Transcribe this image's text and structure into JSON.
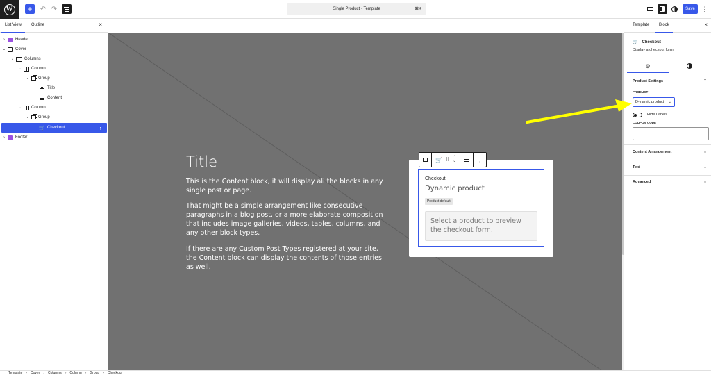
{
  "topbar": {
    "add_label": "+",
    "undo_label": "↶",
    "redo_label": "↷",
    "document_title": "Single Product · Template",
    "shortcut": "⌘K",
    "save_label": "Save",
    "more_label": "⋮"
  },
  "left_panel": {
    "tabs": [
      "List View",
      "Outline"
    ],
    "close_label": "×",
    "tree": [
      {
        "label": "Header",
        "icon": "header-icon"
      },
      {
        "label": "Cover",
        "icon": "cover-icon"
      },
      {
        "label": "Columns",
        "icon": "columns-icon"
      },
      {
        "label": "Column",
        "icon": "column-icon"
      },
      {
        "label": "Group",
        "icon": "group-icon"
      },
      {
        "label": "Title",
        "icon": "title-icon"
      },
      {
        "label": "Content",
        "icon": "content-icon"
      },
      {
        "label": "Column",
        "icon": "column-icon"
      },
      {
        "label": "Group",
        "icon": "group-icon"
      },
      {
        "label": "Checkout",
        "icon": "cart-icon"
      },
      {
        "label": "Footer",
        "icon": "footer-icon"
      }
    ]
  },
  "canvas": {
    "title": "Title",
    "paragraphs": [
      "This is the Content block, it will display all the blocks in any single post or page.",
      "That might be a simple arrangement like consecutive paragraphs in a blog post, or a more elaborate composition that includes image galleries, videos, tables, columns, and any other block types.",
      "If there are any Custom Post Types registered at your site, the Content block can display the contents of those entries as well."
    ],
    "checkout": {
      "label": "Checkout",
      "product": "Dynamic product",
      "badge": "Product default",
      "preview": "Select a product to preview the checkout form."
    }
  },
  "right_panel": {
    "tabs": [
      "Template",
      "Block"
    ],
    "close_label": "×",
    "block_name": "Checkout",
    "block_description": "Display a checkout form.",
    "sections": {
      "product_settings": "Product Settings",
      "content_arrangement": "Content Arrangement",
      "text": "Text",
      "advanced": "Advanced"
    },
    "product_label": "PRODUCT",
    "product_value": "Dynamic product",
    "hide_labels": "Hide Labels",
    "coupon_label": "COUPON CODE",
    "coupon_value": ""
  },
  "breadcrumb": [
    "Template",
    "Cover",
    "Columns",
    "Column",
    "Group",
    "Checkout"
  ],
  "colors": {
    "accent": "#3858e9",
    "canvas_bg": "#717171",
    "annotation": "#ffff00",
    "block_icon": "#9b51e0"
  }
}
